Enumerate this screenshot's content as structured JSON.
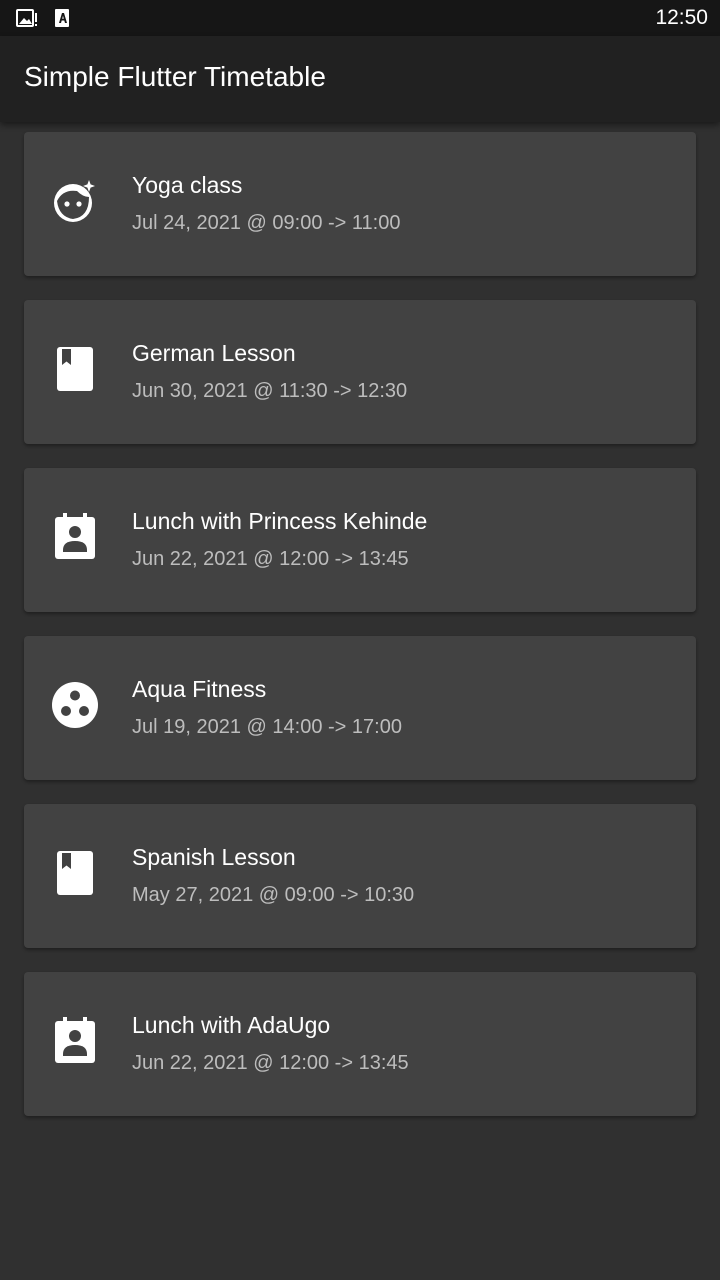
{
  "status_bar": {
    "time": "12:50",
    "icons": [
      "image-alert-icon",
      "font-download-icon"
    ]
  },
  "app_bar": {
    "title": "Simple Flutter Timetable"
  },
  "events": [
    {
      "title": "Yoga class",
      "subtitle": "Jul 24, 2021 @ 09:00 -> 11:00",
      "icon": "face-icon"
    },
    {
      "title": "German Lesson",
      "subtitle": "Jun 30, 2021 @ 11:30 -> 12:30",
      "icon": "book-icon"
    },
    {
      "title": "Lunch with Princess Kehinde",
      "subtitle": "Jun 22, 2021 @ 12:00 -> 13:45",
      "icon": "contact-calendar-icon"
    },
    {
      "title": "Aqua Fitness",
      "subtitle": "Jul 19, 2021 @ 14:00 -> 17:00",
      "icon": "workspaces-icon"
    },
    {
      "title": "Spanish Lesson",
      "subtitle": "May 27, 2021 @ 09:00 -> 10:30",
      "icon": "book-icon"
    },
    {
      "title": "Lunch with AdaUgo",
      "subtitle": "Jun 22, 2021 @ 12:00 -> 13:45",
      "icon": "contact-calendar-icon"
    }
  ]
}
